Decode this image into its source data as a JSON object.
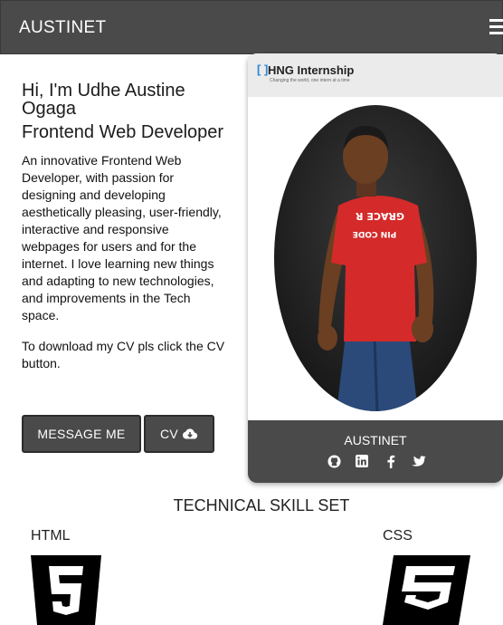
{
  "navbar": {
    "brand": "AUSTINET",
    "menu_icon": "hamburger-icon"
  },
  "intro": {
    "greeting": "Hi, I'm Udhe Austine Ogaga",
    "role": "Frontend Web Developer",
    "bio": "An innovative Frontend Web Developer, with passion for designing and developing aesthetically pleasing, user-friendly, interactive and responsive webpages for users and for the internet. I love learning new things and adapting to new technologies, and improvements in the Tech space.",
    "cv_note": "To download my CV pls click the CV button."
  },
  "buttons": {
    "message": "MESSAGE ME",
    "cv": "CV",
    "cv_icon": "cloud-download-icon"
  },
  "card": {
    "banner_title": "HNG Internship",
    "banner_tagline": "Changing the world, one intern at a time",
    "shirt_text_top": "GRACE R",
    "shirt_text_bottom": "PIN CODE",
    "name": "AUSTINET",
    "social_icons": [
      "github-icon",
      "linkedin-icon",
      "facebook-icon",
      "twitter-icon"
    ]
  },
  "skills": {
    "title": "TECHNICAL SKILL SET",
    "items": [
      {
        "label": "HTML",
        "icon": "html5-icon"
      },
      {
        "label": "CSS",
        "icon": "css3-icon"
      }
    ]
  },
  "colors": {
    "nav_bg": "#4a4a4a",
    "button_bg": "#4a4a4a",
    "hng_blue": "#2c86d8",
    "shirt_red": "#d42a2a"
  }
}
